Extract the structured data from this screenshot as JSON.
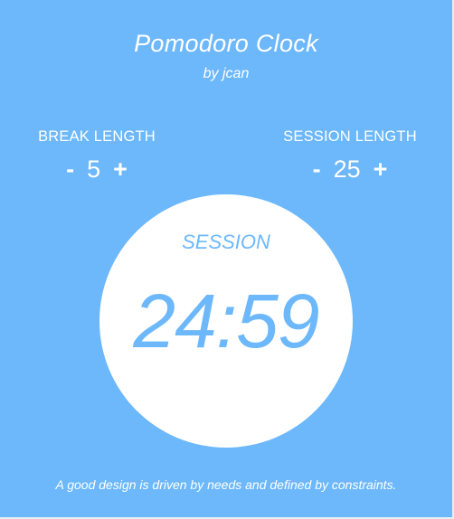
{
  "header": {
    "title": "Pomodoro Clock",
    "subtitle": "by jcan"
  },
  "break": {
    "label": "BREAK LENGTH",
    "decrement": "-",
    "value": "5",
    "increment": "+"
  },
  "session": {
    "label": "SESSION LENGTH",
    "decrement": "-",
    "value": "25",
    "increment": "+"
  },
  "clock": {
    "label": "SESSION",
    "time": "24:59"
  },
  "footer": {
    "quote": "A good design is driven by needs and defined by constraints."
  },
  "colors": {
    "background": "#6db8fb",
    "text": "#ffffff",
    "clock_face": "#ffffff",
    "clock_text": "#6db8fb"
  }
}
